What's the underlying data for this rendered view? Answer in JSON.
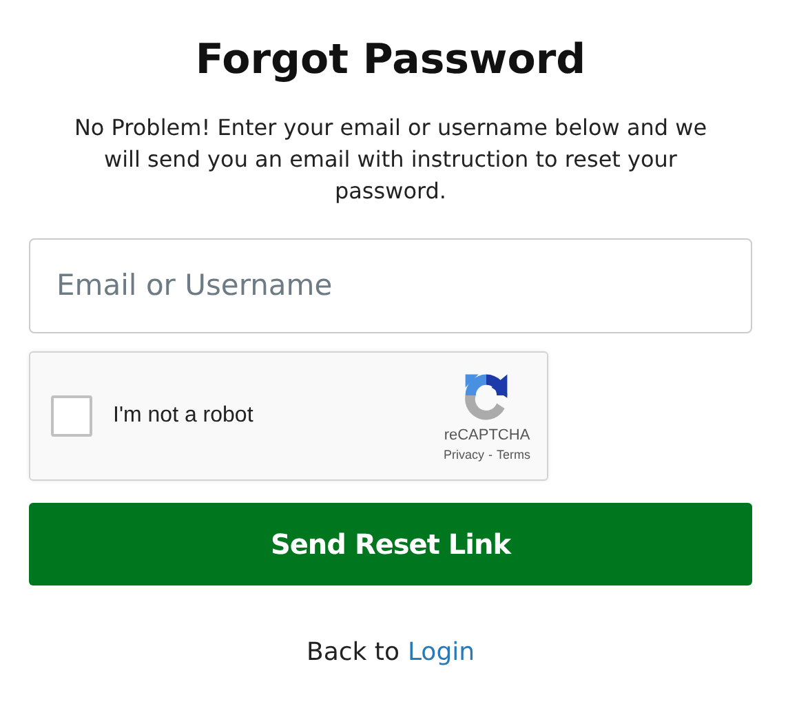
{
  "title": "Forgot Password",
  "description": "No Problem! Enter your email or username below and we will send you an email with instruction to reset your password.",
  "email_field": {
    "placeholder": "Email or Username"
  },
  "captcha": {
    "checked": false,
    "label": "I'm not a robot",
    "brand": "reCAPTCHA",
    "privacy": "Privacy",
    "separator": "-",
    "terms": "Terms"
  },
  "submit_button": "Send Reset Link",
  "footer": {
    "text": "Back to",
    "link": "Login"
  }
}
